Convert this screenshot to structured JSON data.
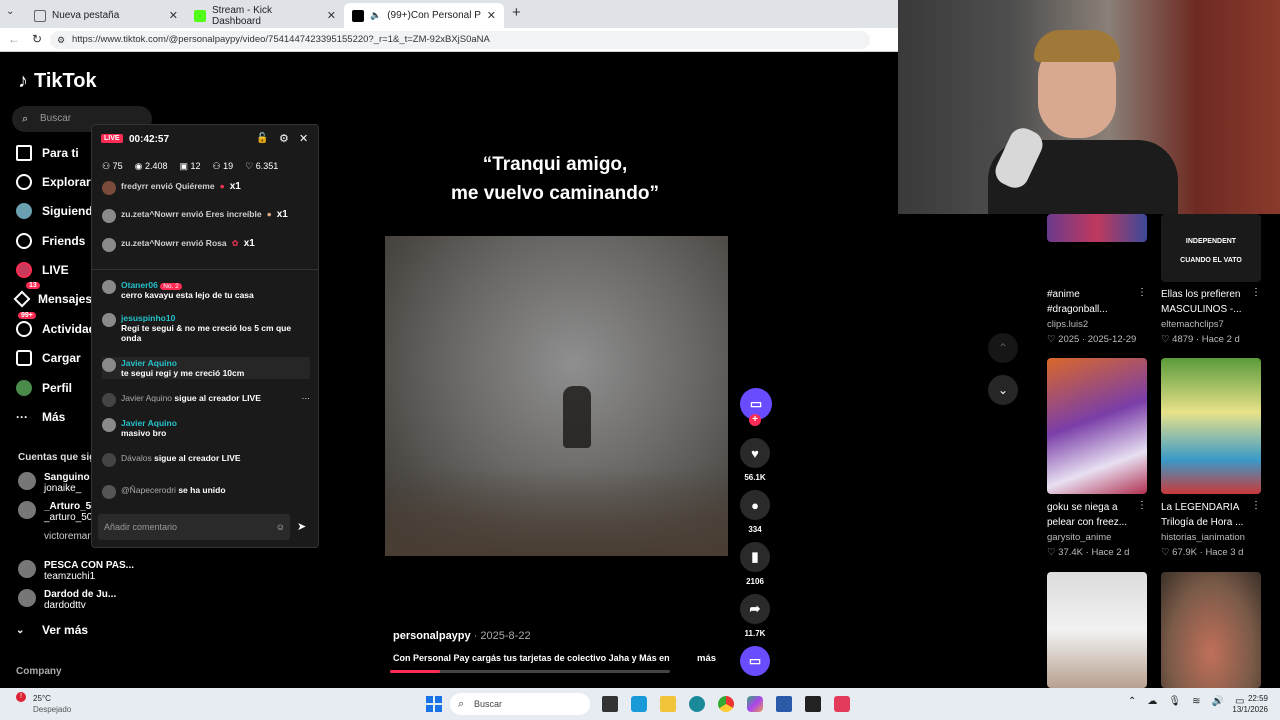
{
  "browser": {
    "tabs": [
      {
        "title": "Nueva pestaña",
        "color": "#5f6368"
      },
      {
        "title": "Stream - Kick Dashboard",
        "color": "#53fc18"
      },
      {
        "title": "(99+)Con Personal Pay cargás",
        "color": "#000000"
      }
    ],
    "url": "https://www.tiktok.com/@personalpaypy/video/7541447423395155220?_r=1&_t=ZM-92xBXjS0aNA"
  },
  "tiktok": {
    "logo": "TikTok",
    "search_placeholder": "Buscar",
    "nav": [
      {
        "label": "Para ti",
        "icon": "home-icon"
      },
      {
        "label": "Explorar",
        "icon": "compass-icon"
      },
      {
        "label": "Siguiendo",
        "icon": "following-icon"
      },
      {
        "label": "Friends",
        "icon": "friends-icon"
      },
      {
        "label": "LIVE",
        "icon": "live-icon"
      },
      {
        "label": "Mensajes",
        "icon": "messages-icon",
        "badge": "13"
      },
      {
        "label": "Actividad",
        "icon": "activity-icon",
        "badge": "99+"
      },
      {
        "label": "Cargar",
        "icon": "upload-icon"
      },
      {
        "label": "Perfil",
        "icon": "profile-icon"
      },
      {
        "label": "Más",
        "icon": "more-icon"
      }
    ],
    "following_title": "Cuentas que sigues",
    "following": [
      {
        "name": "Sanguino",
        "handle": "jonaike_"
      },
      {
        "name": "_Arturo_50",
        "handle": "_arturo_50"
      },
      {
        "name": "",
        "handle": "victoremanuelmeza"
      },
      {
        "name": "PESCA CON PAS...",
        "handle": "teamzuchi1"
      },
      {
        "name": "Dardod de Ju...",
        "handle": "dardodttv"
      }
    ],
    "see_more": "Ver más",
    "company": "Company"
  },
  "live_panel": {
    "badge": "LIVE",
    "time": "00:42:57",
    "stats": {
      "viewers": "75",
      "views": "2.408",
      "gifts": "12",
      "shares": "19",
      "likes": "6.351"
    },
    "gifts": [
      {
        "user": "fredyrr",
        "text": "envió Quiéreme",
        "count": "x1"
      },
      {
        "user": "zu.zeta^Nowrr",
        "text": "envió Eres increíble",
        "count": "x1"
      },
      {
        "user": "zu.zeta^Nowrr",
        "text": "envió Rosa",
        "count": "x1"
      }
    ],
    "comments": [
      {
        "user": "Otaner06",
        "tag": "No. 2",
        "text": "cerro kavayu esta lejo de tu casa"
      },
      {
        "user": "jesuspinho10",
        "tag": "",
        "text": "Regi te segui & no me creció los 5 cm que onda"
      },
      {
        "user": "Javier Aquino",
        "tag": "",
        "text": "te segui regi y me creció 10cm"
      },
      {
        "user": "Javier Aquino",
        "tag": "",
        "text": "sigue al creador LIVE"
      },
      {
        "user": "Javier Aquino",
        "tag": "",
        "text": "masivo bro"
      },
      {
        "user": "Dávalos",
        "tag": "",
        "text": "sigue al creador LIVE"
      },
      {
        "user": "@Ñapecerodri",
        "tag": "",
        "text": "se ha unido"
      }
    ],
    "comment_placeholder": "Añadir comentario"
  },
  "video": {
    "quote_line1": "“Tranqui amigo,",
    "quote_line2": "me vuelvo caminando”",
    "author": "personalpaypy",
    "date": "· 2025-8-22",
    "caption": "Con Personal Pay cargás tus tarjetas de colectivo Jaha y Más en",
    "more": "más",
    "likes": "56.1K",
    "comments": "334",
    "saves": "2106",
    "shares": "11.7K"
  },
  "recommendations": [
    {
      "title": "#anime #dragonball...",
      "author": "clips.luis2",
      "likes": "2025",
      "date": "2025-12-29"
    },
    {
      "title": "Ellas los prefieren MASCULINOS -...",
      "author": "eltemachclips7",
      "likes": "4879",
      "date": "Hace 2 d"
    },
    {
      "title": "goku se niega a pelear con freez...",
      "author": "garysito_anime",
      "likes": "37.4K",
      "date": "Hace 2 d"
    },
    {
      "title": "La LEGENDARIA Trilogía de Hora ...",
      "author": "historias_ianimation",
      "likes": "67.9K",
      "date": "Hace 3 d"
    }
  ],
  "thumb_texts": {
    "t1": "INDEPENDENT",
    "t2": "CUANDO EL VATO"
  },
  "taskbar": {
    "weather_temp": "25°C",
    "weather_desc": "Despejado",
    "search": "Buscar",
    "time": "22:59",
    "date": "13/1/2026"
  }
}
